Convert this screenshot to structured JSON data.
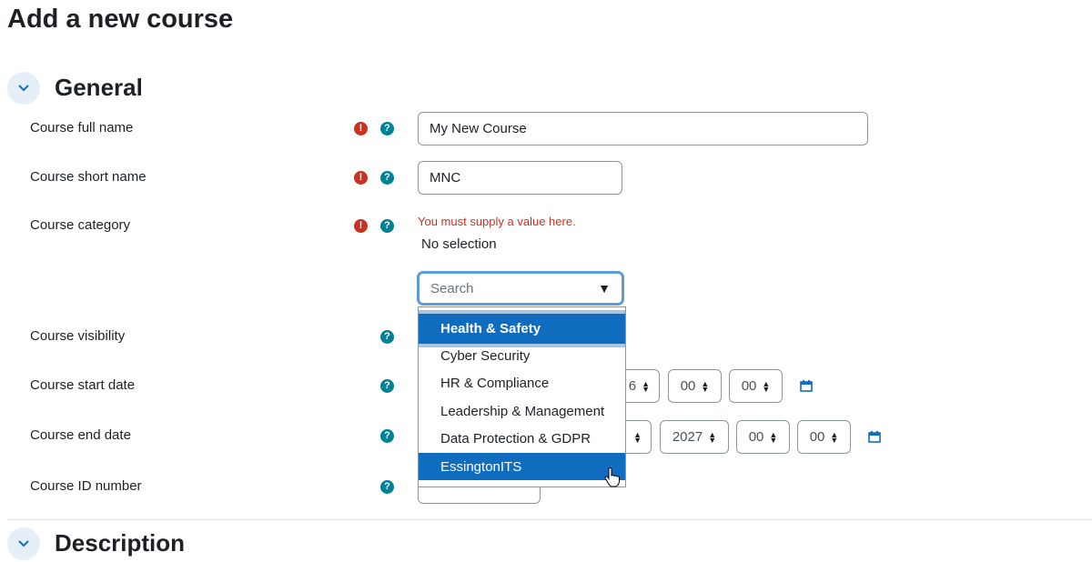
{
  "page": {
    "title": "Add a new course"
  },
  "sections": {
    "general": {
      "title": "General"
    },
    "description": {
      "title": "Description"
    }
  },
  "fields": {
    "fullname": {
      "label": "Course full name",
      "value": "My New Course"
    },
    "shortname": {
      "label": "Course short name",
      "value": "MNC"
    },
    "category": {
      "label": "Course category",
      "error": "You must supply a value here.",
      "selection": "No selection",
      "search_placeholder": "Search",
      "options": [
        "Health & Safety",
        "Cyber Security",
        "HR & Compliance",
        "Leadership & Management",
        "Data Protection & GDPR",
        "EssingtonITS"
      ]
    },
    "visibility": {
      "label": "Course visibility"
    },
    "startdate": {
      "label": "Course start date",
      "partial_day": "6",
      "hour": "00",
      "minute": "00"
    },
    "enddate": {
      "label": "Course end date",
      "year": "2027",
      "hour": "00",
      "minute": "00"
    },
    "idnumber": {
      "label": "Course ID number",
      "value": ""
    }
  },
  "icons": {
    "required": "!",
    "help": "?"
  },
  "colors": {
    "accent": "#0f6cbf",
    "error": "#ca3120",
    "help": "#008196"
  }
}
